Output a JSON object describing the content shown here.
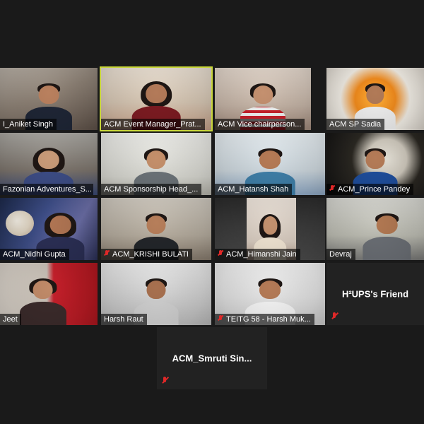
{
  "meeting": {
    "tiles": [
      {
        "name": "I_Aniket Singh",
        "muted": false
      },
      {
        "name": "ACM Event Manager_Prat...",
        "muted": false
      },
      {
        "name": "ACM Vice chairperson...",
        "muted": false
      },
      {
        "name": "ACM SP Sadia",
        "muted": false
      },
      {
        "name": "Fazonian Adventures_S...",
        "muted": false
      },
      {
        "name": "ACM Sponsorship Head_...",
        "muted": false
      },
      {
        "name": "ACM_Hatansh Shah",
        "muted": false
      },
      {
        "name": "ACM_Prince Pandey",
        "muted": true
      },
      {
        "name": "ACM_Nidhi Gupta",
        "muted": false
      },
      {
        "name": "ACM_KRISHI BULATI",
        "muted": true
      },
      {
        "name": "ACM_Himanshi Jain",
        "muted": true
      },
      {
        "name": "Devraj",
        "muted": false
      },
      {
        "name": "Jeet",
        "muted": false
      },
      {
        "name": "Harsh Raut",
        "muted": false
      },
      {
        "name": "TEITG 58 - Harsh Muk...",
        "muted": true
      },
      {
        "name": "H²UPS's Friend",
        "muted": true
      },
      {
        "name": "ACM_Smruti Sin...",
        "muted": true
      }
    ]
  },
  "icons": {
    "muted_mic": "muted-mic-icon"
  },
  "colors": {
    "active_speaker": "#c8d63a",
    "muted_red": "#e02828",
    "background": "#1a1a1a"
  }
}
